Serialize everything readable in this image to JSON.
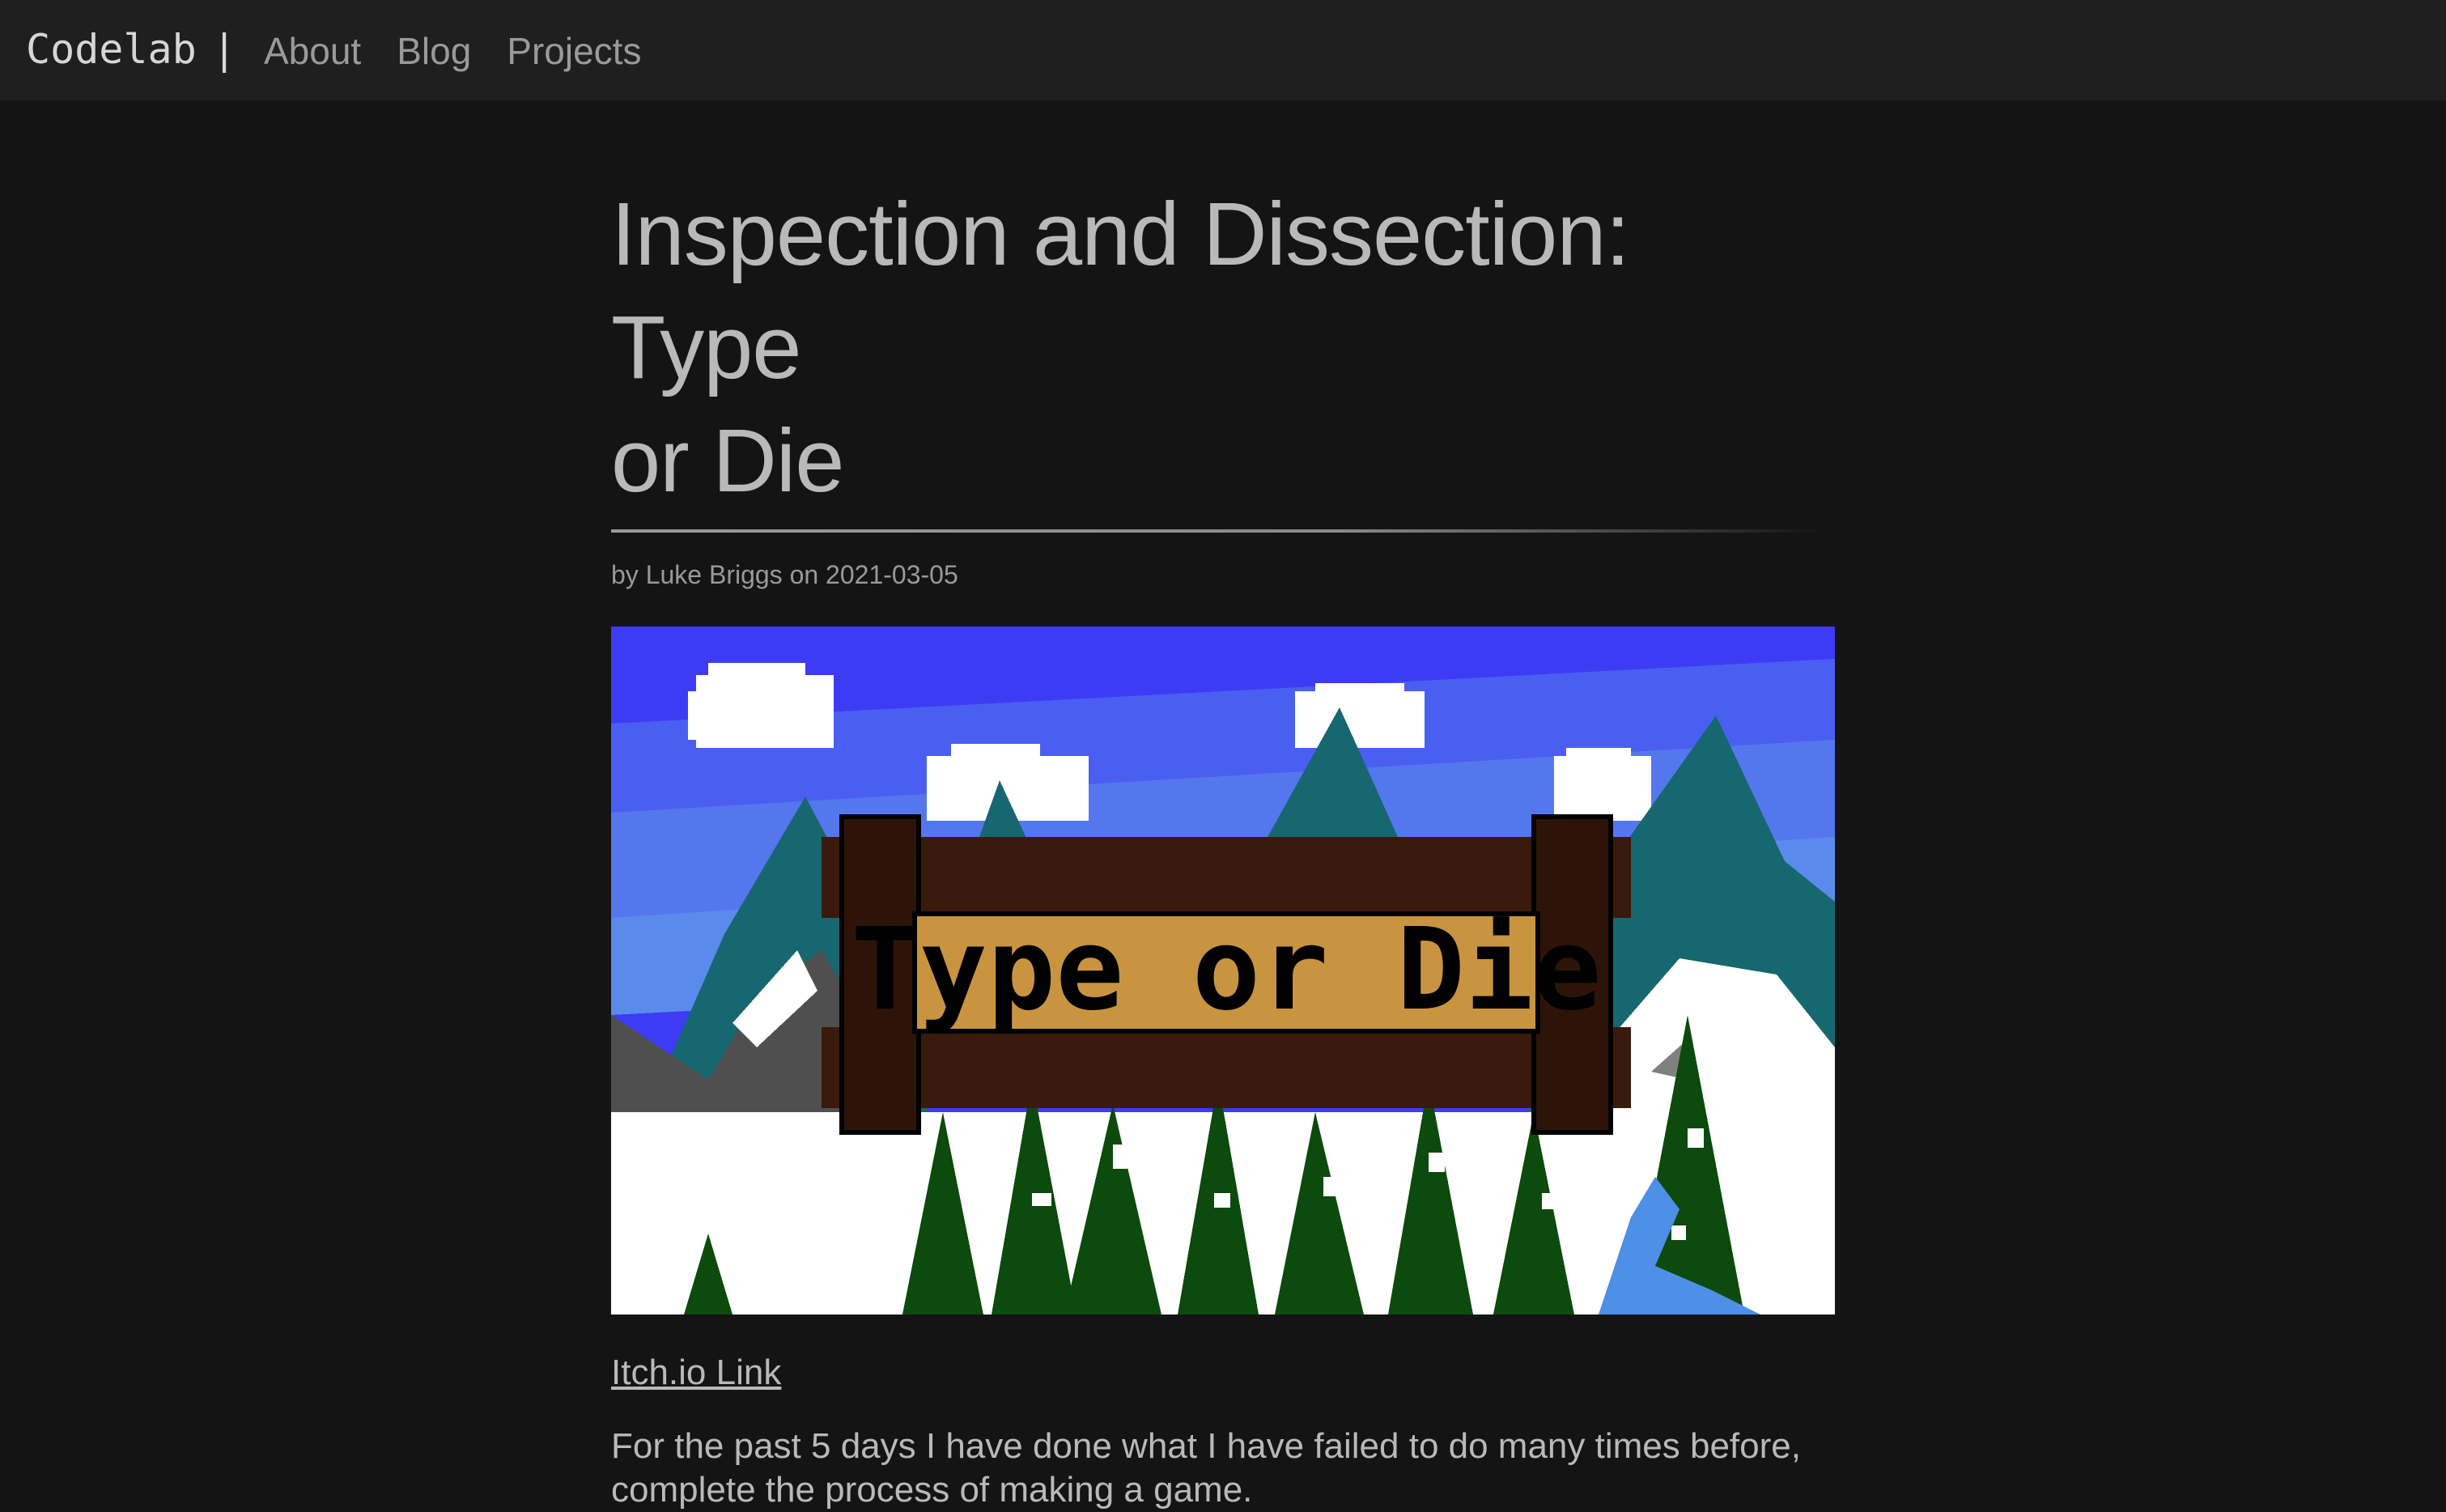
{
  "nav": {
    "brand": "Codelab",
    "separator": "|",
    "links": [
      {
        "label": "About"
      },
      {
        "label": "Blog"
      },
      {
        "label": "Projects"
      }
    ]
  },
  "article": {
    "title_line1": "Inspection and Dissection: Type",
    "title_line2": "or Die",
    "byline": "by Luke Briggs on 2021-03-05",
    "hero_image": {
      "sign_text": "Type or Die"
    },
    "link_label": "Itch.io Link",
    "paragraph_line1": "For the past 5 days I have done what I have failed to do many times before,",
    "paragraph_line2": "complete the process of making a game."
  },
  "colors": {
    "background": "#141414",
    "navbar": "#1f1f1f",
    "text": "#b9b9b9",
    "muted": "#9a9a9a",
    "sky": "#3a3cf5",
    "mountain": "#176770",
    "sign_wood": "#3a1a0c",
    "sign_plank": "#c99440"
  }
}
